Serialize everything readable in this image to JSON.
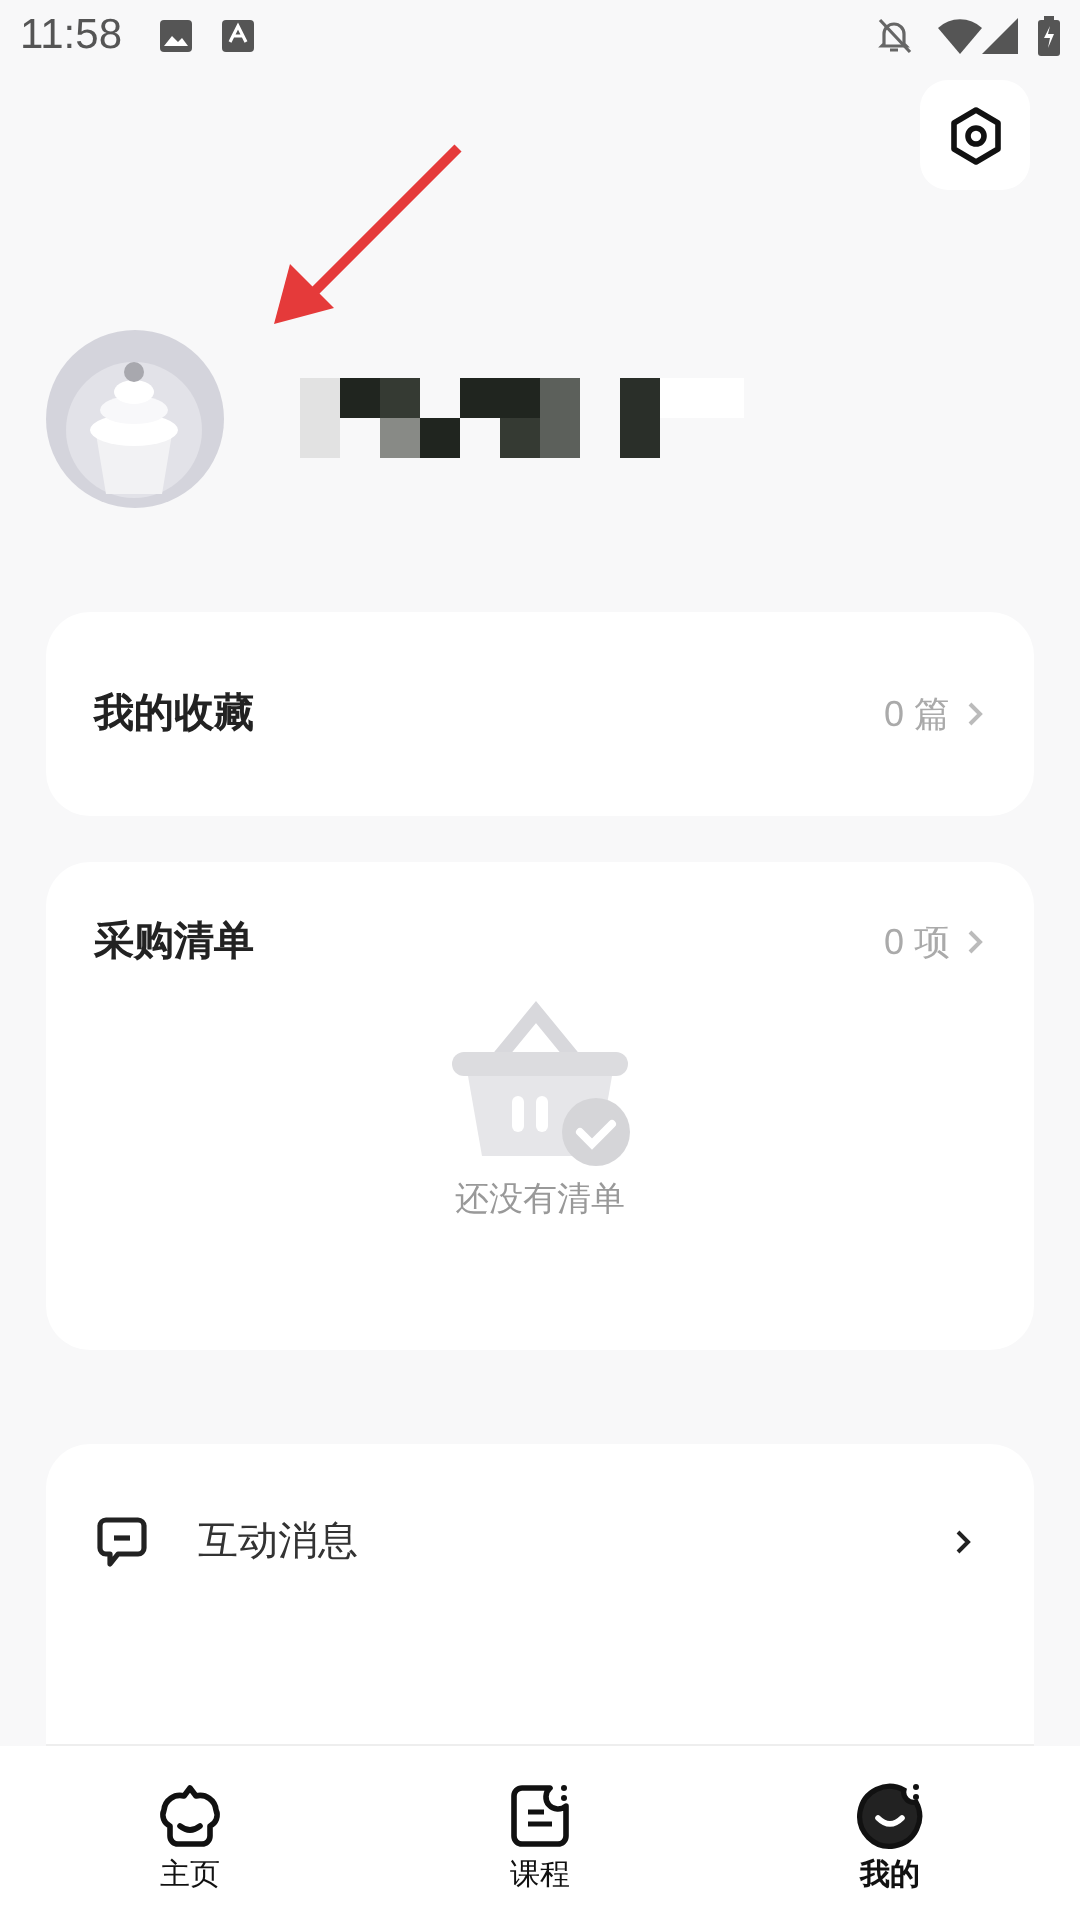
{
  "status_bar": {
    "time": "11:58"
  },
  "favorites": {
    "title": "我的收藏",
    "count": "0 篇"
  },
  "shopping_list": {
    "title": "采购清单",
    "count": "0 项",
    "empty_text": "还没有清单"
  },
  "menu": [
    {
      "kind": "message",
      "label": "互动消息"
    }
  ],
  "tabs": [
    {
      "kind": "home",
      "label": "主页",
      "selected": false
    },
    {
      "kind": "course",
      "label": "课程",
      "selected": false
    },
    {
      "kind": "me",
      "label": "我的",
      "selected": true
    }
  ]
}
